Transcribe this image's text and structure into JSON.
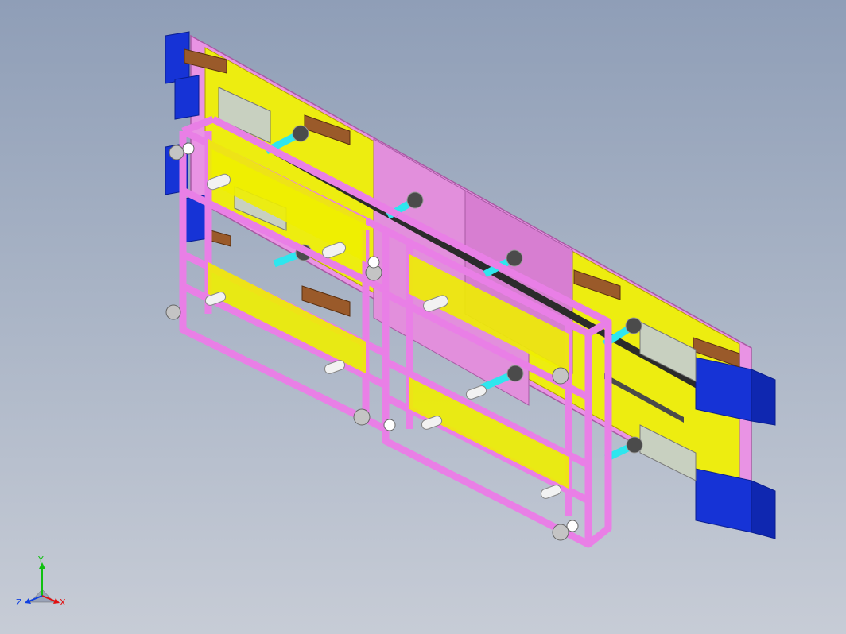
{
  "viewport": {
    "background_top": "#8f9eb7",
    "background_bottom": "#c7ccd6"
  },
  "colors": {
    "frame_magenta": "#e97fe6",
    "frame_magenta_dark": "#b94fb6",
    "panel_yellow": "#eeee00",
    "plate_pink": "#e28fdc",
    "clamp_blue": "#1633d6",
    "clamp_blue_dark": "#0a1e8f",
    "block_brown": "#9a5a2a",
    "shaft_cyan": "#2ee6ee",
    "cylinder_white": "#f2f2f2",
    "steel_gray": "#b8b8b8"
  },
  "triad": {
    "x_label": "X",
    "y_label": "Y",
    "z_label": "Z",
    "x_color": "#e01010",
    "y_color": "#10c010",
    "z_color": "#1040e0"
  }
}
